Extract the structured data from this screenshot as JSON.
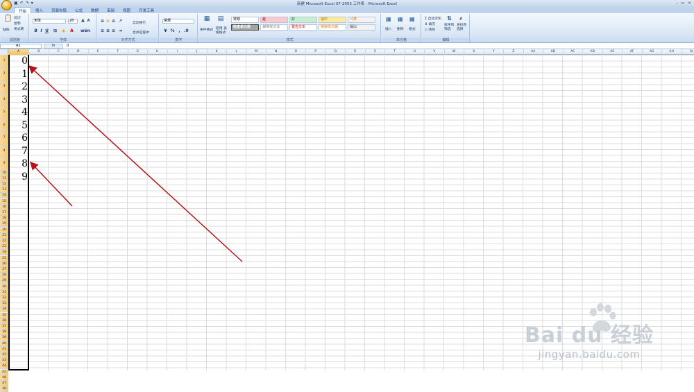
{
  "window": {
    "title": "新建 Microsoft Excel 97-2003 工作表 - Microsoft Excel",
    "controls": [
      "–",
      "▫",
      "×"
    ]
  },
  "tabs": [
    "开始",
    "插入",
    "页面布局",
    "公式",
    "数据",
    "审阅",
    "视图",
    "开发工具"
  ],
  "ribbon": {
    "clipboard": {
      "label": "剪贴板",
      "paste": "粘贴",
      "cut": "剪切",
      "copy": "复制",
      "format_painter": "格式刷"
    },
    "font": {
      "label": "字体",
      "name": "宋体",
      "size": "28"
    },
    "alignment": {
      "label": "对齐方式",
      "wrap": "自动换行",
      "merge": "合并后居中"
    },
    "number": {
      "label": "数字",
      "format": "常规",
      "percent": "%"
    },
    "styles": {
      "label": "样式",
      "conditional": "条件格式",
      "table": "套用 表格格式",
      "cells": [
        "常规",
        "差",
        "好",
        "适中",
        "计算",
        "检查单元格",
        "解释性文本",
        "警告文本",
        "链接单元格",
        "输出"
      ]
    },
    "cells": {
      "label": "单元格",
      "insert": "插入",
      "delete": "删除",
      "format": "格式"
    },
    "editing": {
      "label": "编辑",
      "autosum": "自动求和",
      "fill": "填充",
      "clear": "清除",
      "sort": "排序和 筛选",
      "find": "查找和 选择"
    }
  },
  "formula_bar": {
    "name_box": "A1",
    "fx": "fx",
    "value": "0"
  },
  "columns": [
    "A",
    "B",
    "C",
    "D",
    "E",
    "F",
    "G",
    "H",
    "I",
    "J",
    "K",
    "L",
    "M",
    "N",
    "O",
    "P",
    "Q",
    "R",
    "S",
    "T",
    "U",
    "V",
    "W",
    "X",
    "Y",
    "Z",
    "AA",
    "AB",
    "AC",
    "AD",
    "AE",
    "AF",
    "AG",
    "AH",
    "AI"
  ],
  "rows": [
    "1",
    "2",
    "3",
    "4",
    "5",
    "6",
    "7",
    "8",
    "9",
    "10",
    "11",
    "12",
    "13",
    "14",
    "15",
    "16",
    "17",
    "18",
    "19",
    "20",
    "21",
    "22",
    "23",
    "24",
    "25",
    "26",
    "27",
    "28",
    "29",
    "30",
    "31",
    "32",
    "33",
    "34",
    "35",
    "36",
    "37",
    "38",
    "39",
    "40",
    "41",
    "42",
    "43",
    "44",
    "45",
    "46",
    "47",
    "48"
  ],
  "cells_A": [
    "0",
    "1",
    "2",
    "3",
    "4",
    "5",
    "6",
    "7",
    "8",
    "9"
  ],
  "annotation": {
    "color": "#b5121b"
  },
  "watermark": {
    "logo": "Bai du 经验",
    "url": "jingyan.baidu.com"
  }
}
